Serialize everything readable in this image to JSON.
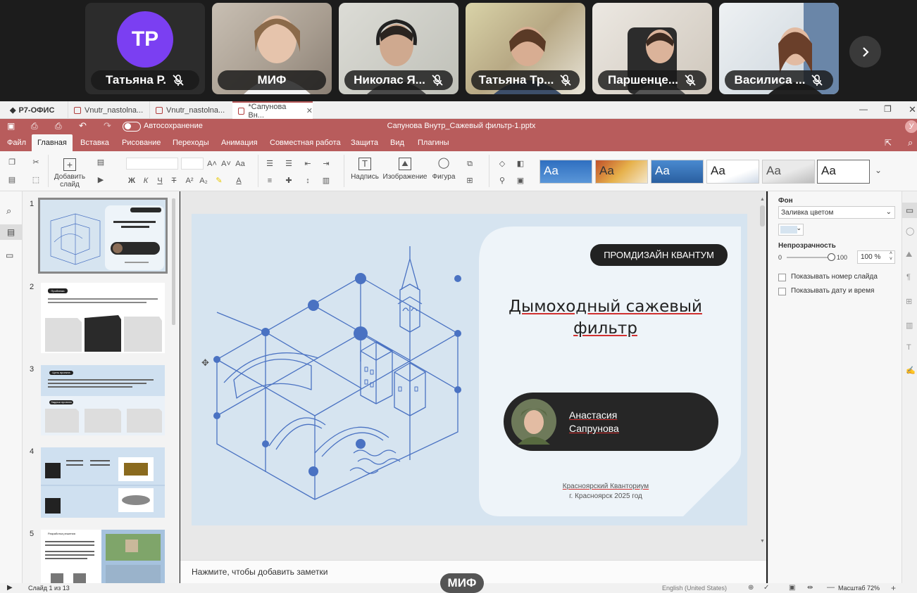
{
  "call": {
    "participants": [
      {
        "name": "Татьяна Р.",
        "initials": "ТР",
        "muted": true
      },
      {
        "name": "МИФ",
        "muted": false
      },
      {
        "name": "Николас Я...",
        "muted": true
      },
      {
        "name": "Татьяна Тр...",
        "muted": true
      },
      {
        "name": "Паршенце...",
        "muted": true
      },
      {
        "name": "Василиса ...",
        "muted": true
      }
    ],
    "active_speaker": "МИФ",
    "avatar_color": "#7b3ff2"
  },
  "window": {
    "app_name": "Р7-ОФИС",
    "tabs": [
      {
        "label": "Vnutr_nastolna..."
      },
      {
        "label": "Vnutr_nastolna..."
      },
      {
        "label": "*Сапунова Вн..."
      }
    ],
    "doc_title": "Сапунова Внутр_Сажевый фильтр-1.pptx",
    "autosave_label": "Автосохранение",
    "user_initial": "У"
  },
  "menu": {
    "items": [
      "Файл",
      "Главная",
      "Вставка",
      "Рисование",
      "Переходы",
      "Анимация",
      "Совместная работа",
      "Защита",
      "Вид",
      "Плагины"
    ],
    "active": "Главная"
  },
  "toolbar": {
    "add_slide": "Добавить слайд",
    "textbox": "Надпись",
    "image": "Изображение",
    "shape": "Фигура",
    "themes_label": "Aa"
  },
  "slides": {
    "numbers": [
      "1",
      "2",
      "3",
      "4",
      "5"
    ],
    "t2_title": "Проблема",
    "t3_title": "Цель проекта",
    "t3_sub": "Задачи проекта",
    "t5_title": "Разработка решения"
  },
  "slide": {
    "badge": "ПРОМДИЗАЙН КВАНТУМ",
    "title_line1": "Дымоходный сажевый",
    "title_line2": "фильтр",
    "author_line1": "Анастасия",
    "author_line2": "Сапрунова",
    "org": "Красноярский Кванториум",
    "city_year": "г. Красноярск 2025 год"
  },
  "notes": {
    "placeholder": "Нажмите, чтобы добавить заметки"
  },
  "right_panel": {
    "bg_label": "Фон",
    "fill_select": "Заливка цветом",
    "opacity_label": "Непрозрачность",
    "opacity_min": "0",
    "opacity_max": "100",
    "opacity_value": "100 %",
    "opacity_level": 100,
    "show_slide_number": "Показывать номер слайда",
    "show_date": "Показывать дату и время",
    "fill_color": "#d6e4f0"
  },
  "status": {
    "slide_of": "Слайд 1 из 13",
    "language": "English (United States)",
    "zoom": "Масштаб 72%"
  },
  "colors": {
    "brand_red": "#b85c5c",
    "slide_bg": "#d6e4f0",
    "line_blue": "#4a72c2"
  }
}
